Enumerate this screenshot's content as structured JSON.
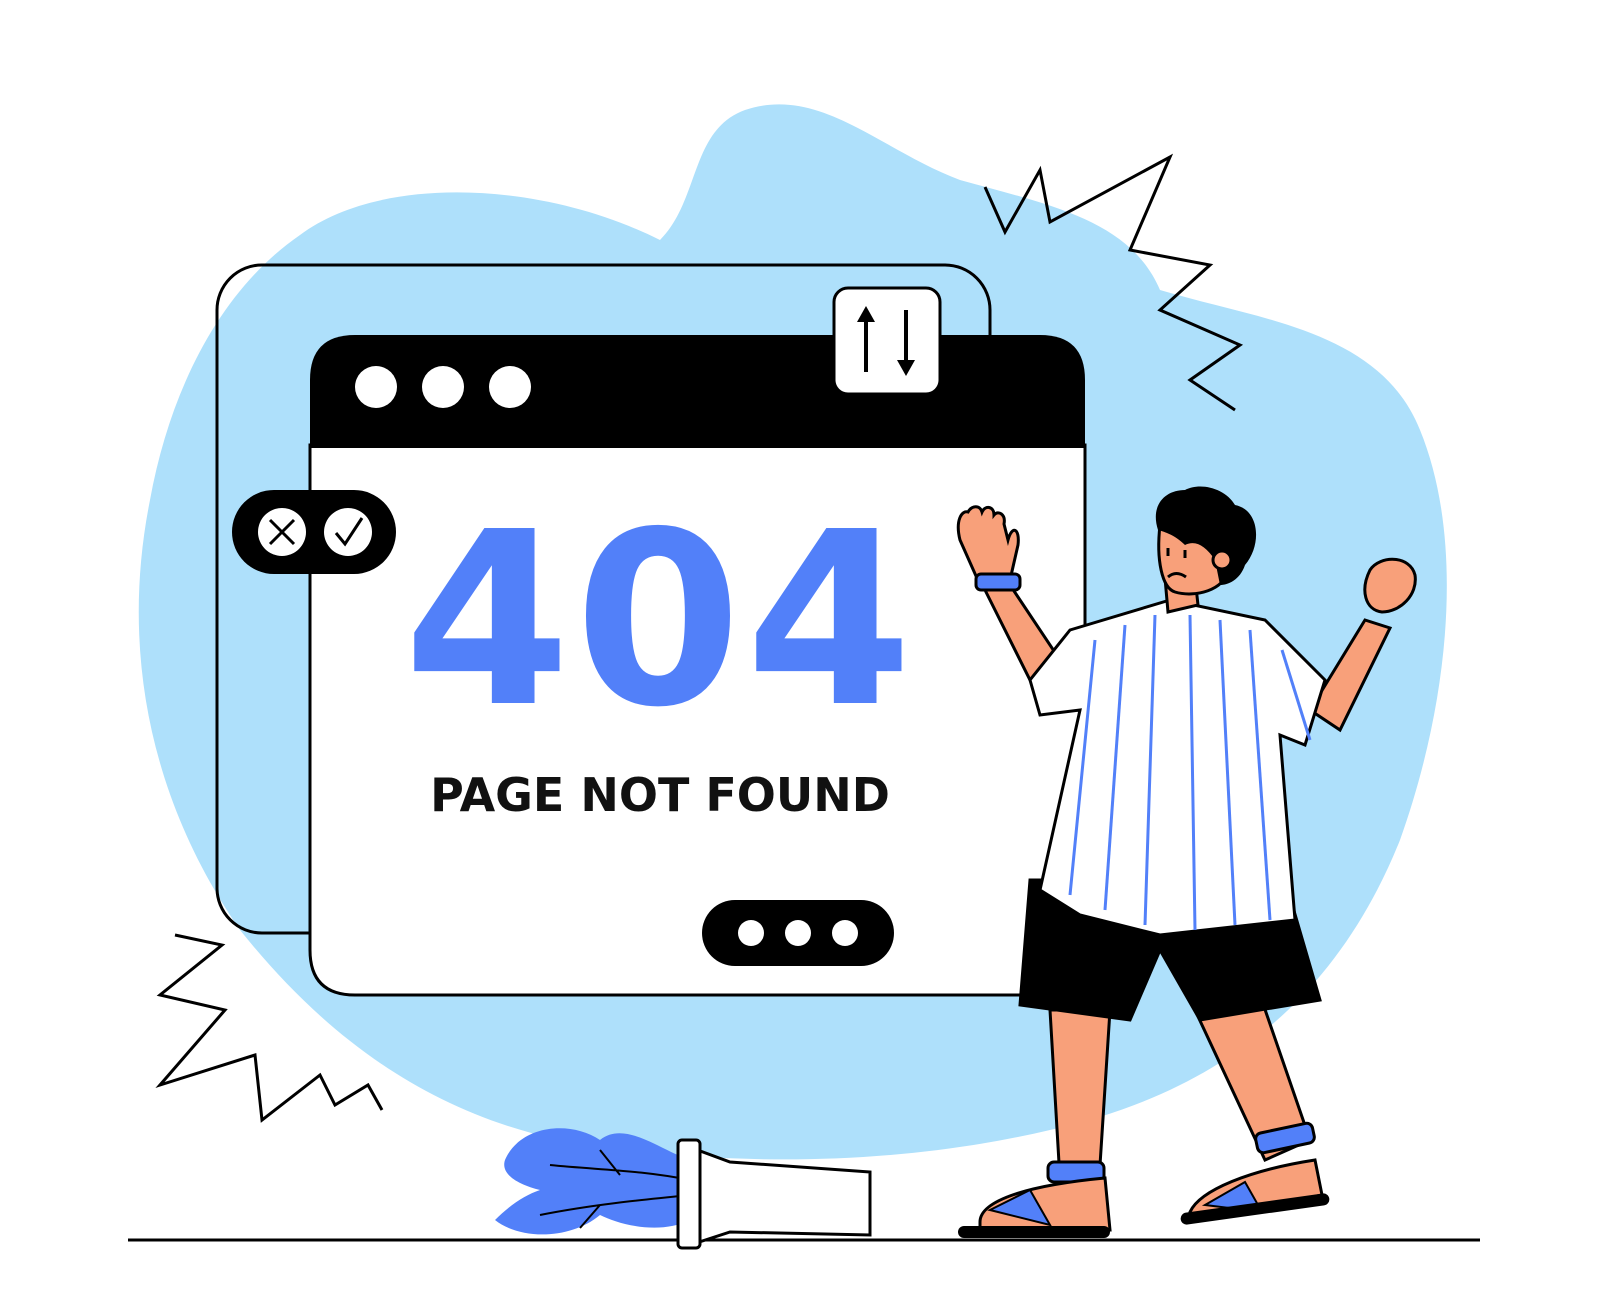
{
  "error": {
    "code": "404",
    "message": "PAGE NOT FOUND"
  },
  "icons": {
    "transfer": "up-down-arrows-icon",
    "close": "x-circle-icon",
    "confirm": "check-circle-icon",
    "menu": "three-dots-icon"
  },
  "colors": {
    "accent": "#5280f9",
    "blob": "#aee0fb",
    "skin": "#f8a07a",
    "ink": "#000000",
    "paper": "#ffffff"
  }
}
